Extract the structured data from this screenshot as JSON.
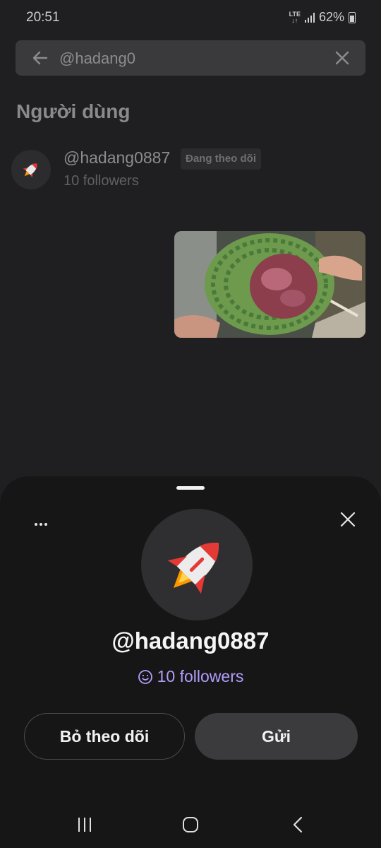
{
  "status": {
    "time": "20:51",
    "network": "LTE",
    "battery": "62%"
  },
  "search": {
    "query": "@hadang0"
  },
  "section": {
    "title": "Người dùng"
  },
  "user_row": {
    "username": "@hadang0887",
    "badge": "Đang theo dõi",
    "followers": "10 followers",
    "avatar_icon": "rocket-icon"
  },
  "profile_sheet": {
    "username": "@hadang0887",
    "followers": "10 followers",
    "unfollow_label": "Bỏ theo dõi",
    "send_label": "Gửi",
    "avatar_icon": "rocket-icon",
    "accent_color": "#b39dfa"
  }
}
